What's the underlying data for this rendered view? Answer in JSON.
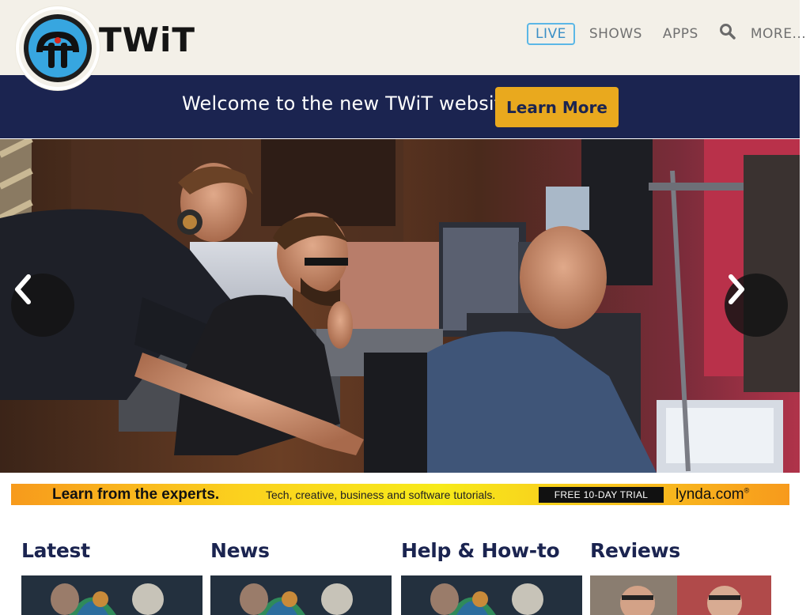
{
  "header": {
    "brand": "TWiT",
    "nav": {
      "live": "LIVE",
      "shows": "SHOWS",
      "apps": "APPS",
      "more": "MORE..."
    }
  },
  "welcome": {
    "text": "Welcome to the new TWiT website",
    "button": "Learn More"
  },
  "carousel": {
    "prev_icon": "chevron-left-icon",
    "next_icon": "chevron-right-icon"
  },
  "ad": {
    "headline": "Learn from the experts.",
    "subtext": "Tech, creative, business and software tutorials.",
    "cta": "FREE 10-DAY TRIAL",
    "brand": "lynda.com",
    "brand_mark": "®"
  },
  "sections": [
    {
      "title": "Latest"
    },
    {
      "title": "News"
    },
    {
      "title": "Help & How-to"
    },
    {
      "title": "Reviews"
    }
  ],
  "colors": {
    "header_bg": "#f3f0e8",
    "navy": "#1b2450",
    "accent_gold": "#e9a91e",
    "logo_blue": "#37a6e0",
    "live_border": "#5bb7e6"
  }
}
